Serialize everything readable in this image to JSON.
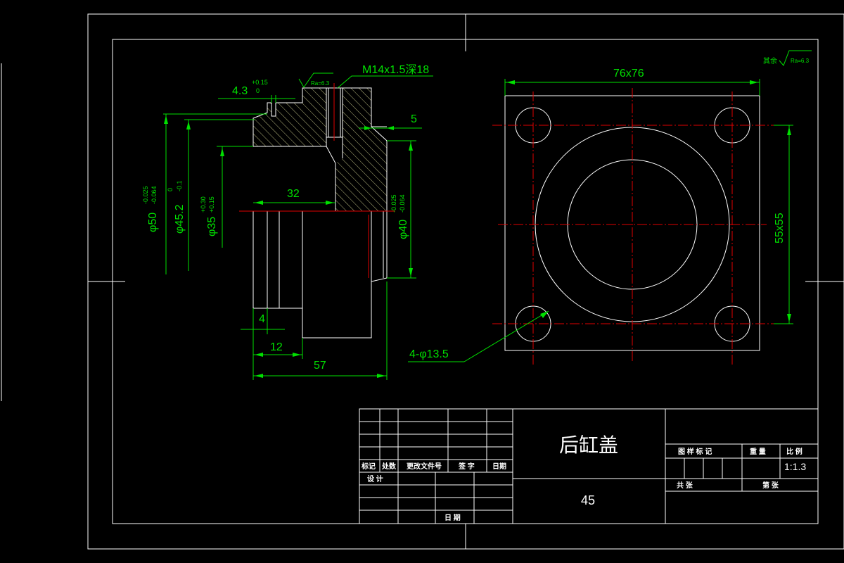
{
  "colors": {
    "background": "#000000",
    "outline": "#ffffff",
    "dimension": "#00e000",
    "centerline": "#e00000"
  },
  "dimensions": {
    "thread": "M14x1.5深18",
    "roughness_top": "Ra=6.3",
    "roughness_general": "Ra=6.3",
    "roughness_prefix": "其余",
    "step_len": "4.3",
    "step_tol_upper": "+0.15",
    "step_tol_lower": "0",
    "five": "5",
    "d50": "φ50",
    "d50_tol_upper": "-0.025",
    "d50_tol_lower": "-0.064",
    "d452": "φ45.2",
    "d452_tol_upper": "0",
    "d452_tol_lower": "-0.1",
    "d35": "φ35",
    "d35_tol_upper": "+0.30",
    "d35_tol_lower": "+0.15",
    "d40": "φ40",
    "d40_tol_upper": "-0.025",
    "d40_tol_lower": "-0.064",
    "len32": "32",
    "len4": "4",
    "len12": "12",
    "len57": "57",
    "square": "76x76",
    "holes": "4-φ13.5",
    "spacing": "55x55"
  },
  "title_block": {
    "part_name": "后缸盖",
    "material": "45",
    "scale": "1:1.3",
    "rev_headers": [
      "标记",
      "处数",
      "更改文件号",
      "签 字",
      "日期"
    ],
    "design": "设 计",
    "date": "日 期",
    "right_headers": [
      "图 样 标 记",
      "重 量",
      "比 例"
    ],
    "total": "共    张",
    "sheet": "第    张"
  }
}
